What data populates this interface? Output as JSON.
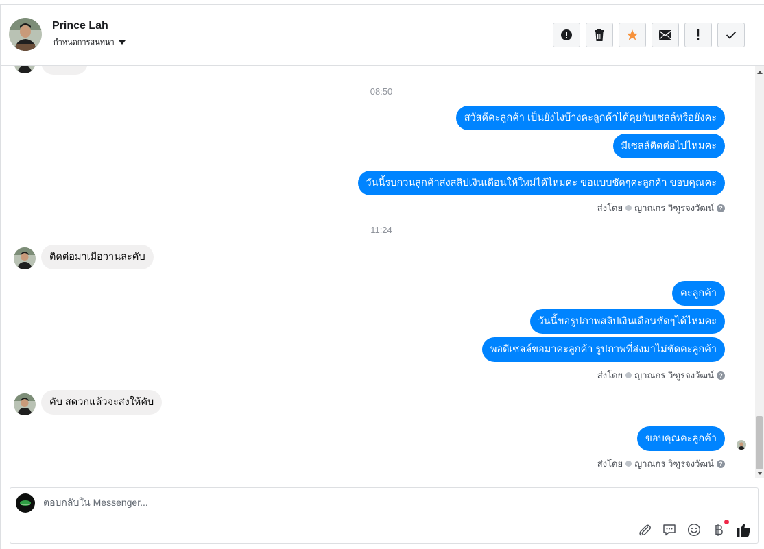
{
  "header": {
    "contact_name": "Prince Lah",
    "contact_sub": "กำหนดการสนทนา",
    "toolbar": [
      {
        "name": "report-icon",
        "label": "!"
      },
      {
        "name": "trash-icon"
      },
      {
        "name": "star-icon",
        "color": "#f7923b"
      },
      {
        "name": "mail-icon"
      },
      {
        "name": "spam-button",
        "label": "!"
      },
      {
        "name": "check-icon"
      }
    ]
  },
  "conversation": {
    "time_1": "08:50",
    "time_2": "11:24",
    "out_1": "สวัสดีคะลูกค้า เป็นยังไงบ้างคะลูกค้าได้คุยกับเซลล์หรือยังคะ",
    "out_2": "มีเซลล์ติดต่อไปไหมคะ",
    "out_3": "วันนี้รบกวนลูกค้าส่งสลิปเงินเดือนให้ใหม่ได้ไหมคะ ขอแบบชัดๆคะลูกค้า ขอบคุณคะ",
    "in_1": "ติดต่อมาเมื่อวานละคับ",
    "out_4": "คะลูกค้า",
    "out_5": "วันนี้ขอรูปภาพสลิปเงินเดือนชัดๆได้ไหมคะ",
    "out_6": "พอดีเซลล์ขอมาคะลูกค้า รูปภาพที่ส่งมาไม่ชัดคะลูกค้า",
    "in_2": "คับ สดวกแล้วจะส่งให้คับ",
    "out_7": "ขอบคุณคะลูกค้า",
    "sent_by_label": "ส่งโดย",
    "sent_by_name": "ญาณกร วิฑูรจงวัฒน์",
    "help": "?"
  },
  "composer": {
    "placeholder": "ตอบกลับใน Messenger...",
    "tools": [
      "paperclip-icon",
      "speech-bubble-icon",
      "emoji-icon",
      "baht-icon",
      "like-icon"
    ]
  },
  "colors": {
    "outgoing_bubble": "#0084ff",
    "incoming_bubble": "#f1f0f0",
    "star": "#f7923b"
  }
}
